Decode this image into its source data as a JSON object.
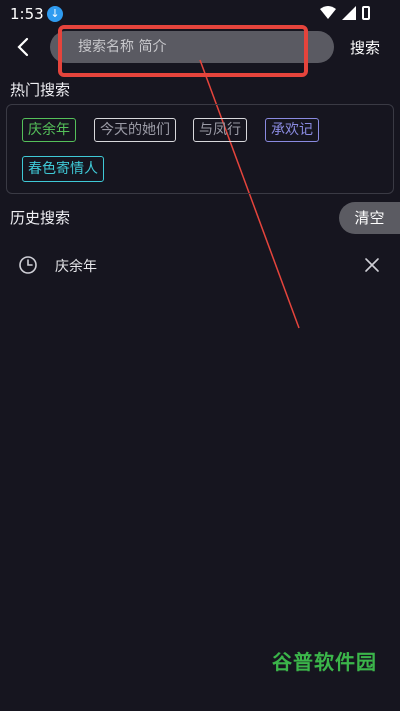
{
  "status_bar": {
    "time": "1:53"
  },
  "search": {
    "placeholder": "搜索名称 简介",
    "button_label": "搜索"
  },
  "hot_search": {
    "title": "热门搜索",
    "tags": [
      {
        "label": "庆余年",
        "color": "#55c05a"
      },
      {
        "label": "今天的她们",
        "color": "#9b9ba6"
      },
      {
        "label": "与凤行",
        "color": "#9b9ba6"
      },
      {
        "label": "承欢记",
        "color": "#8a8ae0"
      },
      {
        "label": "春色寄情人",
        "color": "#3fc9d6"
      }
    ]
  },
  "history": {
    "title": "历史搜索",
    "clear_label": "清空",
    "items": [
      {
        "label": "庆余年"
      }
    ]
  },
  "watermark": "谷普软件园",
  "colors": {
    "annotation": "#e5443c",
    "background": "#16151f"
  }
}
